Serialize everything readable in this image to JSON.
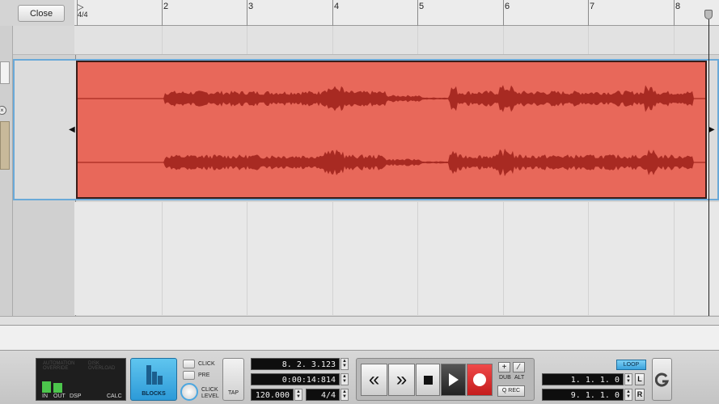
{
  "toolbar": {
    "close_label": "Close"
  },
  "ruler": {
    "time_signature": "4/4",
    "bars": [
      "2",
      "3",
      "4",
      "5",
      "6",
      "7",
      "8"
    ]
  },
  "clip": {
    "color": "#e8685a",
    "waveform_color": "#a82a22"
  },
  "meter": {
    "automation_label": "AUTOMATION OVERRIDE",
    "disk_label": "DISK OVERLOAD",
    "in_label": "IN",
    "out_label": "OUT",
    "dsp_label": "DSP",
    "calc_label": "CALC"
  },
  "blocks": {
    "label": "BLOCKS"
  },
  "click": {
    "click_label": "CLICK",
    "pre_label": "PRE",
    "level_label_1": "CLICK",
    "level_label_2": "LEVEL"
  },
  "tap": {
    "label": "TAP"
  },
  "position": {
    "bars_beats": "8. 2. 3.123",
    "time": "0:00:14:814",
    "tempo": "120.000",
    "signature": "4/4"
  },
  "transport": {
    "rewind_icon": "«",
    "forward_icon": "»",
    "dub_label": "DUB",
    "alt_label": "ALT",
    "qrec_label": "Q REC"
  },
  "loop": {
    "loop_label": "LOOP",
    "left_locator": "1. 1. 1.  0",
    "right_locator": "9. 1. 1.  0",
    "left_btn": "L",
    "right_btn": "R"
  }
}
